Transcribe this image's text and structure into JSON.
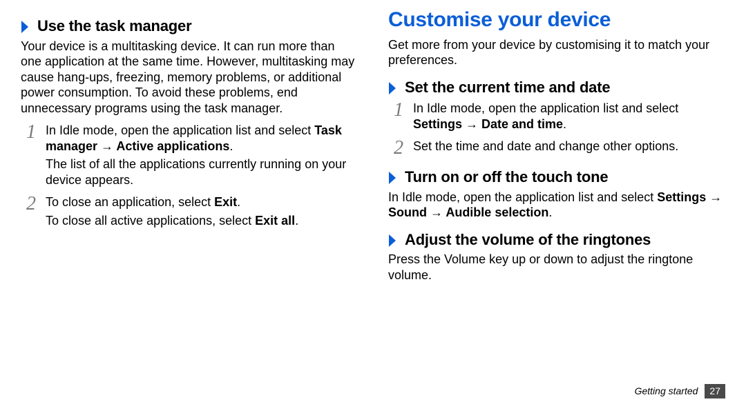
{
  "left": {
    "sub_task_manager": {
      "title": "Use the task manager",
      "intro": "Your device is a multitasking device. It can run more than one application at the same time. However, multitasking may cause hang-ups, freezing, memory problems, or additional power consumption. To avoid these problems, end unnecessary programs using the task manager.",
      "step1_a": "In Idle mode, open the application list and select ",
      "step1_b_bold": "Task manager → Active applications",
      "step1_c": ".",
      "step1_d": "The list of all the applications currently running on your device appears.",
      "step2_a": "To close an application, select ",
      "step2_b_bold": "Exit",
      "step2_c": ".",
      "step2_d": "To close all active applications, select ",
      "step2_e_bold": "Exit all",
      "step2_f": "."
    }
  },
  "right": {
    "section_title": "Customise your device",
    "section_intro": "Get more from your device by customising it to match your preferences.",
    "sub_time": {
      "title": "Set the current time and date",
      "step1_a": "In Idle mode, open the application list and select ",
      "step1_b_bold": "Settings → Date and time",
      "step1_c": ".",
      "step2": "Set the time and date and change other options."
    },
    "sub_touchtone": {
      "title": "Turn on or off the touch tone",
      "body_a": "In Idle mode, open the application list and select ",
      "body_b_bold": "Settings → Sound → Audible selection",
      "body_c": "."
    },
    "sub_volume": {
      "title": "Adjust the volume of the ringtones",
      "body": "Press the Volume key up or down to adjust the ringtone volume."
    }
  },
  "footer": {
    "label": "Getting started",
    "page": "27"
  }
}
